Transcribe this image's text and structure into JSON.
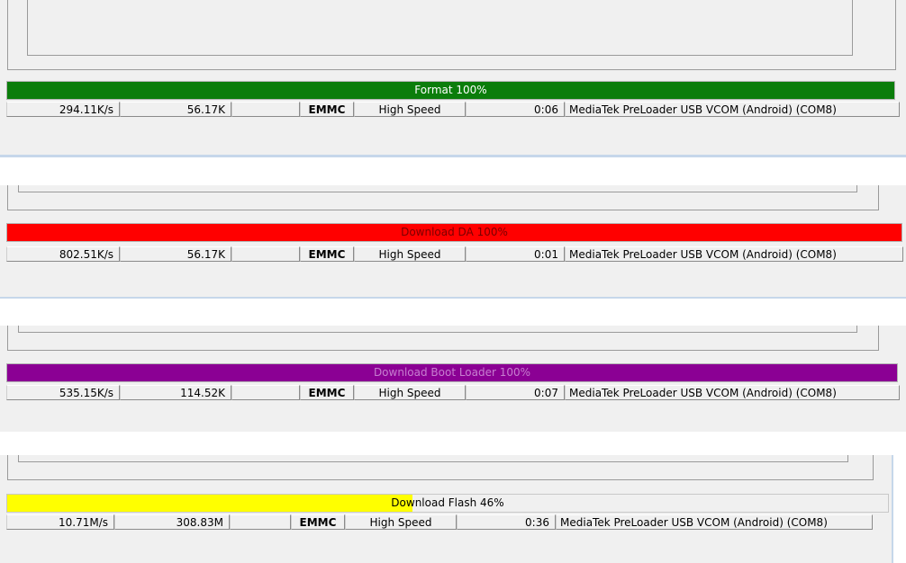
{
  "panels": [
    {
      "progress": {
        "label": "Format 100%",
        "percent": 100,
        "fill_color": "#0b7d0b",
        "text_color": "#ffffff"
      },
      "status": {
        "speed": "294.11K/s",
        "size": "56.17K",
        "storage": "EMMC",
        "mode": "High Speed",
        "time": "0:06",
        "port": "MediaTek PreLoader USB VCOM (Android) (COM8)"
      }
    },
    {
      "progress": {
        "label": "Download DA 100%",
        "percent": 100,
        "fill_color": "#ff0000",
        "text_color": "#7a0000"
      },
      "status": {
        "speed": "802.51K/s",
        "size": "56.17K",
        "storage": "EMMC",
        "mode": "High Speed",
        "time": "0:01",
        "port": "MediaTek PreLoader USB VCOM (Android) (COM8)"
      }
    },
    {
      "progress": {
        "label": "Download Boot Loader 100%",
        "percent": 100,
        "fill_color": "#8b0094",
        "text_color": "#c77fd0"
      },
      "status": {
        "speed": "535.15K/s",
        "size": "114.52K",
        "storage": "EMMC",
        "mode": "High Speed",
        "time": "0:07",
        "port": "MediaTek PreLoader USB VCOM (Android) (COM8)"
      }
    },
    {
      "progress": {
        "label": "Download Flash 46%",
        "percent": 46,
        "fill_color": "#ffff00",
        "text_color": "#000000"
      },
      "status": {
        "speed": "10.71M/s",
        "size": "308.83M",
        "storage": "EMMC",
        "mode": "High Speed",
        "time": "0:36",
        "port": "MediaTek PreLoader USB VCOM (Android) (COM8)"
      }
    }
  ]
}
